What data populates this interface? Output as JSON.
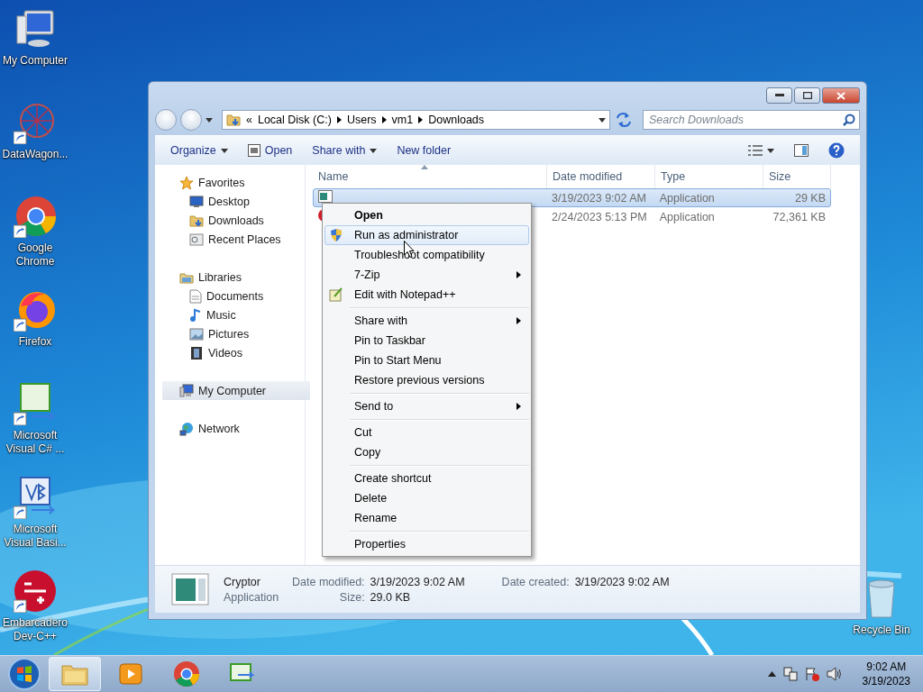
{
  "desktop_icons": [
    {
      "label": "My Computer"
    },
    {
      "label": "DataWagon..."
    },
    {
      "label": "Google Chrome"
    },
    {
      "label": "Firefox"
    },
    {
      "label": "Microsoft Visual C# ..."
    },
    {
      "label": "Microsoft Visual Basi..."
    },
    {
      "label": "Embarcadero Dev-C++"
    }
  ],
  "recycle_bin": {
    "label": "Recycle Bin"
  },
  "explorer": {
    "address": {
      "prefix": "«",
      "segments": [
        "Local Disk (C:)",
        "Users",
        "vm1",
        "Downloads"
      ]
    },
    "search": {
      "placeholder": "Search Downloads"
    },
    "toolbar": [
      {
        "label": "Organize",
        "dropdown": true
      },
      {
        "label": "Open",
        "dropdown": false
      },
      {
        "label": "Share with",
        "dropdown": true
      },
      {
        "label": "New folder",
        "dropdown": false
      }
    ],
    "nav": [
      {
        "label": "Favorites",
        "selected": false,
        "children": [
          {
            "label": "Desktop",
            "selected": false
          },
          {
            "label": "Downloads",
            "selected": false
          },
          {
            "label": "Recent Places",
            "selected": false
          }
        ]
      },
      {
        "label": "Libraries",
        "selected": false,
        "children": [
          {
            "label": "Documents",
            "selected": false
          },
          {
            "label": "Music",
            "selected": false
          },
          {
            "label": "Pictures",
            "selected": false
          },
          {
            "label": "Videos",
            "selected": false
          }
        ]
      },
      {
        "label": "My Computer",
        "selected": true
      },
      {
        "label": "Network",
        "selected": false
      }
    ],
    "columns": [
      "Name",
      "Date modified",
      "Type",
      "Size"
    ],
    "rows": [
      {
        "date": "3/19/2023 9:02 AM",
        "type": "Application",
        "size": "29 KB",
        "selected": true
      },
      {
        "date": "2/24/2023 5:13 PM",
        "type": "Application",
        "size": "72,361 KB",
        "selected": false
      }
    ],
    "details": {
      "name": "Cryptor",
      "type": "Application",
      "fields": [
        {
          "label": "Date modified:",
          "value": "3/19/2023 9:02 AM"
        },
        {
          "label": "Size:",
          "value": "29.0 KB"
        },
        {
          "label": "Date created:",
          "value": "3/19/2023 9:02 AM"
        }
      ]
    }
  },
  "context_menu": {
    "groups": [
      [
        {
          "label": "Open",
          "default": true,
          "selected": false,
          "submenu": false
        },
        {
          "label": "Run as administrator",
          "default": false,
          "selected": true,
          "submenu": false
        },
        {
          "label": "Troubleshoot compatibility",
          "default": false,
          "selected": false,
          "submenu": false
        },
        {
          "label": "7-Zip",
          "default": false,
          "selected": false,
          "submenu": true
        },
        {
          "label": "Edit with Notepad++",
          "default": false,
          "selected": false,
          "submenu": false
        }
      ],
      [
        {
          "label": "Share with",
          "default": false,
          "selected": false,
          "submenu": true
        },
        {
          "label": "Pin to Taskbar",
          "default": false,
          "selected": false,
          "submenu": false
        },
        {
          "label": "Pin to Start Menu",
          "default": false,
          "selected": false,
          "submenu": false
        },
        {
          "label": "Restore previous versions",
          "default": false,
          "selected": false,
          "submenu": false
        }
      ],
      [
        {
          "label": "Send to",
          "default": false,
          "selected": false,
          "submenu": true
        }
      ],
      [
        {
          "label": "Cut",
          "default": false,
          "selected": false,
          "submenu": false
        },
        {
          "label": "Copy",
          "default": false,
          "selected": false,
          "submenu": false
        }
      ],
      [
        {
          "label": "Create shortcut",
          "default": false,
          "selected": false,
          "submenu": false
        },
        {
          "label": "Delete",
          "default": false,
          "selected": false,
          "submenu": false
        },
        {
          "label": "Rename",
          "default": false,
          "selected": false,
          "submenu": false
        }
      ],
      [
        {
          "label": "Properties",
          "default": false,
          "selected": false,
          "submenu": false
        }
      ]
    ]
  },
  "taskbar": {
    "apps": [
      {
        "selected": true
      },
      {
        "selected": false
      },
      {
        "selected": false
      },
      {
        "selected": false
      }
    ],
    "clock": {
      "time": "9:02 AM",
      "date": "3/19/2023"
    }
  }
}
